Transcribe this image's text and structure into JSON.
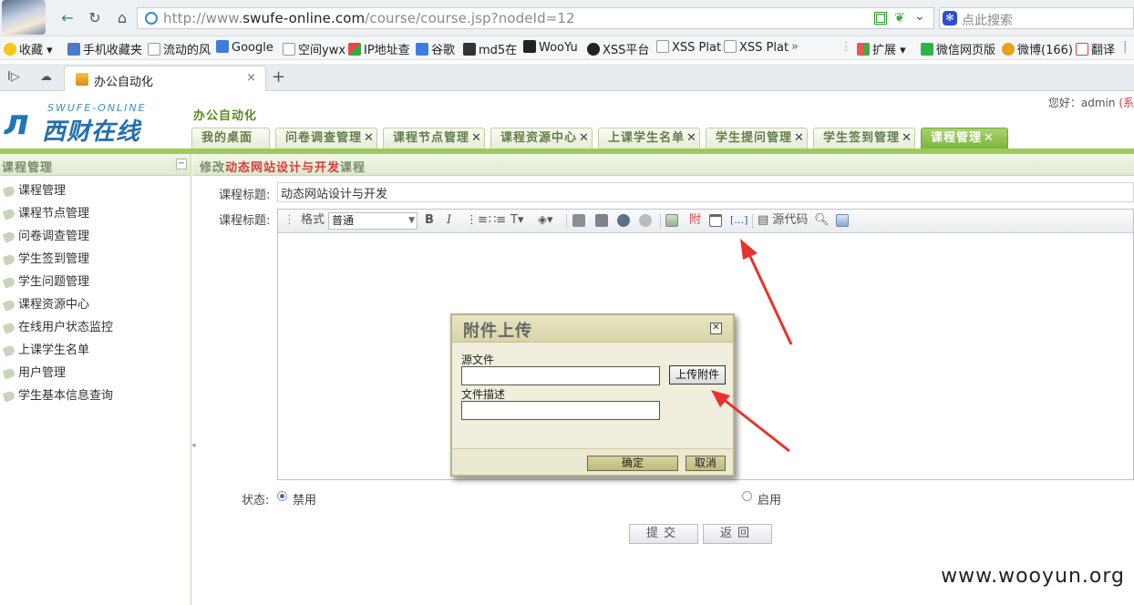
{
  "browser": {
    "url": {
      "prefix": "http://www.",
      "domain": "swufe-online.com",
      "path": "/course/course.jsp?nodeId=12"
    },
    "search_placeholder": "点此搜索",
    "bookmarks": [
      "收藏",
      "手机收藏夹",
      "流动的风",
      "Google",
      "空间ywx",
      "IP地址查",
      "谷歌",
      "md5在",
      "WooYu",
      "XSS平台",
      "XSS Plat",
      "XSS Plat",
      "扩展",
      "微信网页版",
      "微博(166)",
      "翻译"
    ],
    "tab_title": "办公自动化"
  },
  "header": {
    "logo_en": "SWUFE-ONLINE",
    "logo_cn": "西财在线",
    "system_title": "办公自动化",
    "greeting_prefix": "您好：admin",
    "greeting_suffix": "(系"
  },
  "nav_tabs": [
    {
      "label": "我的桌面",
      "closable": false
    },
    {
      "label": "问卷调查管理",
      "closable": true
    },
    {
      "label": "课程节点管理",
      "closable": true
    },
    {
      "label": "课程资源中心",
      "closable": true
    },
    {
      "label": "上课学生名单",
      "closable": true
    },
    {
      "label": "学生提问管理",
      "closable": true
    },
    {
      "label": "学生签到管理",
      "closable": true
    },
    {
      "label": "课程管理",
      "closable": true,
      "active": true
    }
  ],
  "sidebar": {
    "title": "课程管理",
    "items": [
      "课程管理",
      "课程节点管理",
      "问卷调查管理",
      "学生签到管理",
      "学生问题管理",
      "课程资源中心",
      "在线用户状态监控",
      "上课学生名单",
      "用户管理",
      "学生基本信息查询"
    ]
  },
  "main": {
    "heading_prefix": "修改",
    "heading_course": "动态网站设计与开发",
    "heading_suffix": "课程",
    "title_label": "课程标题:",
    "title_value": "动态网站设计与开发",
    "content_label": "课程标题:",
    "toolbar": {
      "format_label": "格式",
      "format_value": "普通",
      "attach_label": "附",
      "source_label": "源代码"
    },
    "status_label": "状态:",
    "status_disabled": "禁用",
    "status_enabled": "启用",
    "submit_label": "提交",
    "back_label": "返回"
  },
  "dialog": {
    "title": "附件上传",
    "source_label": "源文件",
    "upload_button": "上传附件",
    "desc_label": "文件描述",
    "ok_button": "确定",
    "cancel_button": "取消"
  },
  "watermark": "www.wooyun.org",
  "colors": {
    "accent_green": "#9ccb5c",
    "highlight_red": "#e03a3a",
    "arrow_red": "#e8322e"
  }
}
